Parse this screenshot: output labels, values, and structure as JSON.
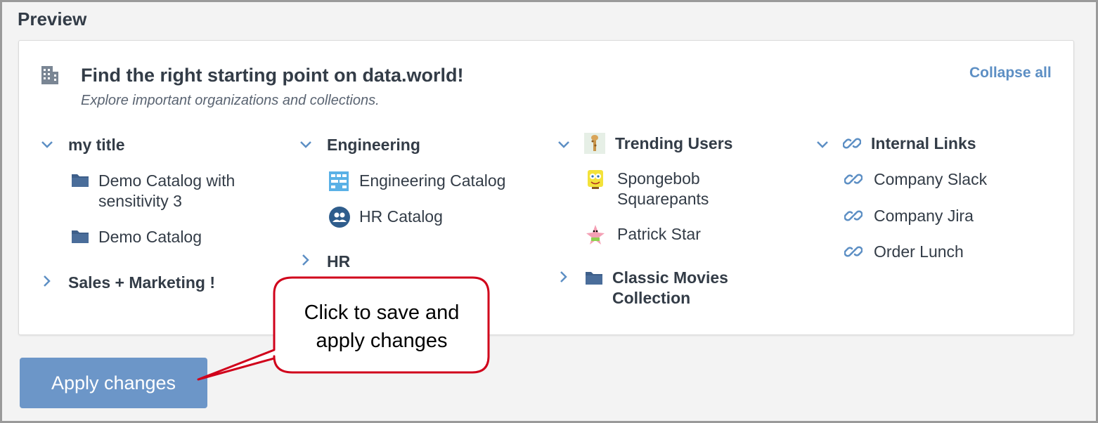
{
  "preview_title": "Preview",
  "card": {
    "title": "Find the right starting point on data.world!",
    "subtitle": "Explore important organizations and collections.",
    "collapse_all": "Collapse all",
    "header_icon": "building-icon"
  },
  "columns": [
    {
      "groups": [
        {
          "label": "my title",
          "state": "expanded",
          "items": [
            {
              "label": "Demo Catalog with sensitivity 3",
              "icon": "folder-icon"
            },
            {
              "label": "Demo Catalog",
              "icon": "folder-icon"
            }
          ]
        },
        {
          "label": "Sales + Marketing !",
          "state": "collapsed"
        }
      ]
    },
    {
      "groups": [
        {
          "label": "Engineering",
          "state": "expanded",
          "items": [
            {
              "label": "Engineering Catalog",
              "icon": "engineering-catalog-icon"
            },
            {
              "label": "HR Catalog",
              "icon": "people-icon"
            }
          ]
        },
        {
          "label": "HR",
          "state": "collapsed"
        }
      ]
    },
    {
      "groups": [
        {
          "label": "Trending Users",
          "state": "expanded",
          "icon": "giraffe-avatar-icon",
          "items": [
            {
              "label": "Spongebob Squarepants",
              "icon": "spongebob-avatar-icon"
            },
            {
              "label": "Patrick Star",
              "icon": "patrick-avatar-icon"
            }
          ]
        },
        {
          "label": "Classic Movies Collection",
          "state": "collapsed",
          "icon": "folder-icon"
        }
      ]
    },
    {
      "groups": [
        {
          "label": "Internal Links",
          "state": "expanded",
          "icon": "link-icon",
          "items": [
            {
              "label": "Company Slack",
              "icon": "link-icon"
            },
            {
              "label": "Company Jira",
              "icon": "link-icon"
            },
            {
              "label": "Order Lunch",
              "icon": "link-icon"
            }
          ]
        }
      ]
    }
  ],
  "apply_button": "Apply changes",
  "callout": {
    "line1": "Click to save and",
    "line2": "apply changes"
  },
  "colors": {
    "accent": "#6c96c8",
    "link": "#5d8fc4",
    "text": "#333c47",
    "callout_border": "#d0021b",
    "folder": "#3e5f8a"
  }
}
